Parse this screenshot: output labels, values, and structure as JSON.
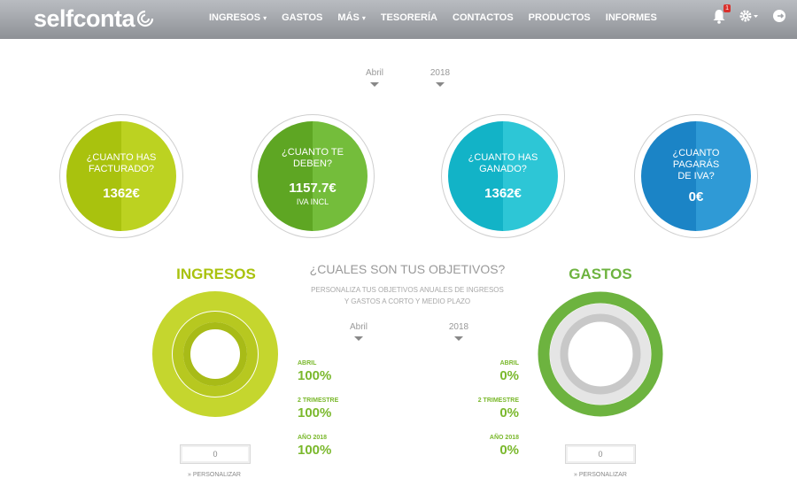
{
  "header": {
    "logo_text": "selfconta",
    "nav": [
      {
        "label": "INGRESOS",
        "dropdown": true
      },
      {
        "label": "GASTOS",
        "dropdown": false
      },
      {
        "label": "MÁS",
        "dropdown": true
      },
      {
        "label": "TESORERÍA",
        "dropdown": false
      },
      {
        "label": "CONTACTOS",
        "dropdown": false
      },
      {
        "label": "PRODUCTOS",
        "dropdown": false
      },
      {
        "label": "INFORMES",
        "dropdown": false
      }
    ],
    "notifications_count": "1",
    "icons": [
      "bell-icon",
      "gear-icon",
      "logout-icon"
    ]
  },
  "period": {
    "month": "Abril",
    "year": "2018"
  },
  "kpis": [
    {
      "label": "¿CUANTO HAS FACTURADO?",
      "value": "1362€",
      "sub": "",
      "color_a": "#a9c20e",
      "color_b": "#bcd221"
    },
    {
      "label": "¿CUANTO TE DEBEN?",
      "value": "1157.7€",
      "sub": "IVA INCL",
      "color_a": "#5ea623",
      "color_b": "#74bd3b"
    },
    {
      "label": "¿CUANTO HAS GANADO?",
      "value": "1362€",
      "sub": "",
      "color_a": "#12b3c7",
      "color_b": "#2dc6d6"
    },
    {
      "label": "¿CUANTO PAGARÁS DE IVA?",
      "value": "0€",
      "sub": "",
      "color_a": "#1b84c6",
      "color_b": "#2f9ad6"
    }
  ],
  "objectives": {
    "title": "¿CUALES SON TUS OBJETIVOS?",
    "subtitle_line1": "PERSONALIZA TUS OBJETIVOS ANUALES DE INGRESOS",
    "subtitle_line2": "Y GASTOS A CORTO Y MEDIO PLAZO",
    "month": "Abril",
    "year": "2018"
  },
  "ingresos": {
    "title": "INGRESOS",
    "color": "#a9c20e",
    "input_value": "0",
    "personalizar": "» PERSONALIZAR",
    "stats": [
      {
        "label": "ABRIL",
        "value": "100%"
      },
      {
        "label": "2 TRIMESTRE",
        "value": "100%"
      },
      {
        "label": "AÑO 2018",
        "value": "100%"
      }
    ]
  },
  "gastos": {
    "title": "GASTOS",
    "color": "#6db33f",
    "input_value": "0",
    "personalizar": "» PERSONALIZAR",
    "stats": [
      {
        "label": "ABRIL",
        "value": "0%"
      },
      {
        "label": "2 TRIMESTRE",
        "value": "0%"
      },
      {
        "label": "AÑO 2018",
        "value": "0%"
      }
    ]
  }
}
